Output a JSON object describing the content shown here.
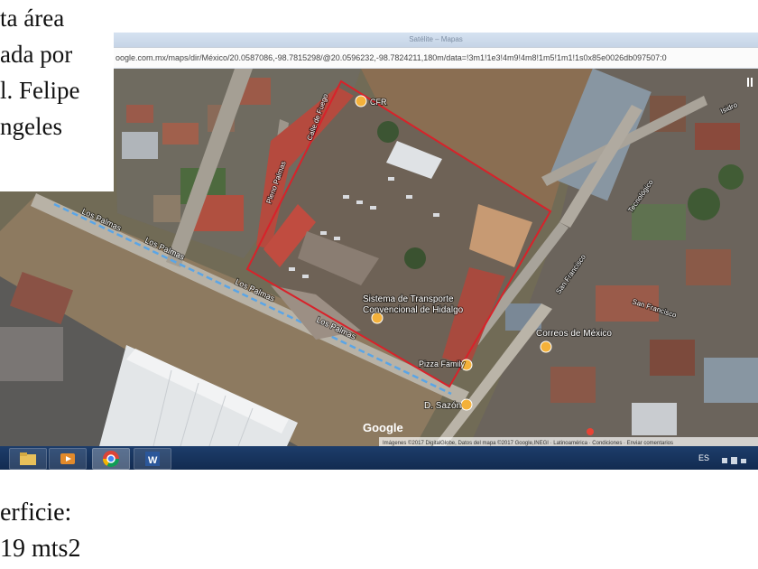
{
  "caption": {
    "line1": "ta área",
    "line2": "ada por",
    "line3": "l. Felipe",
    "line4": "ngeles"
  },
  "surface": {
    "label": "erficie:",
    "value": "19 mts2"
  },
  "browser": {
    "title": "Satélite – Mapas",
    "url": "oogle.com.mx/maps/dir/México/20.0587086,-98.7815298/@20.0596232,-98.7824211,180m/data=!3m1!1e3!4m9!4m8!1m5!1m1!1s0x85e0026db097507:0"
  },
  "map": {
    "places": {
      "cfr": "CFR",
      "transport": "Sistema de Transporte",
      "transport2": "Convencional de Hidalgo",
      "pizza": "Pizza Family",
      "sazon": "D. Sazón",
      "correos": "Correos de México",
      "google": "Google"
    },
    "streets": {
      "los_palmas_1": "Los Palmas",
      "los_palmas_2": "Los Palmas",
      "los_palmas_3": "Los Palmas",
      "los_palmas_4": "Los Palmas",
      "tecnologico": "Tecnológico",
      "san_francisco_1": "San Francisco",
      "san_francisco_2": "San Francisco",
      "isidro": "Isidro",
      "calle_top": "Calle de Fuego",
      "pleno": "Pleno Palmas"
    },
    "footer": "Imágenes ©2017 DigitalGlobe, Datos del mapa ©2017 Google,INEGI · Latinoamérica · Condiciones · Enviar comentarios"
  },
  "taskbar": {
    "lang": "ES",
    "apps": [
      "file-explorer-icon",
      "media-player-icon",
      "chrome-icon",
      "word-icon"
    ]
  },
  "colors": {
    "boundary": "#d8222a",
    "taskbar": "#1b375f",
    "chrome_red": "#db4437",
    "word_blue": "#2b579a"
  }
}
